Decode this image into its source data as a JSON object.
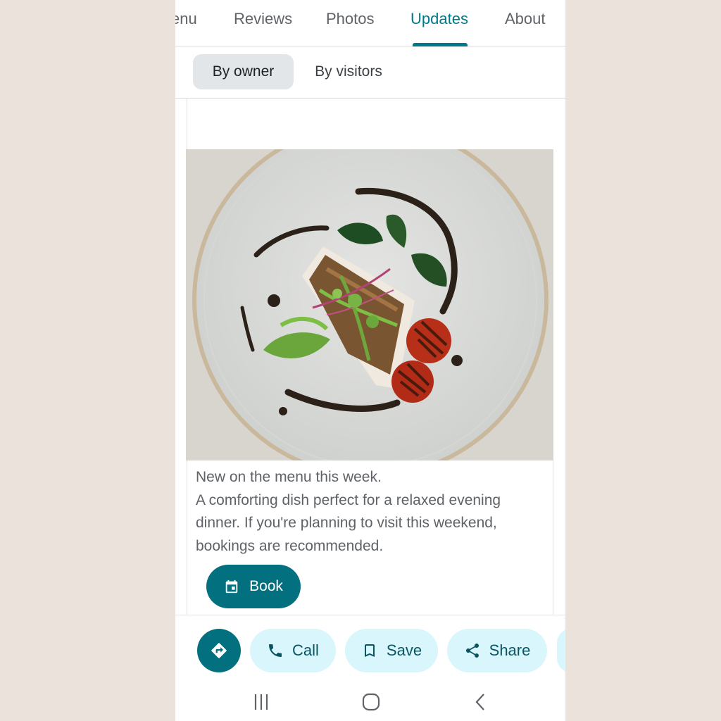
{
  "tabs": [
    {
      "label": "enu",
      "active": false
    },
    {
      "label": "Reviews",
      "active": false
    },
    {
      "label": "Photos",
      "active": false
    },
    {
      "label": "Updates",
      "active": true
    },
    {
      "label": "About",
      "active": false
    }
  ],
  "filter_chips": [
    {
      "label": "By owner",
      "selected": true
    },
    {
      "label": "By visitors",
      "selected": false
    }
  ],
  "post": {
    "image_icon": "plated-fish-dish-photo",
    "line1": "New on the menu this week.",
    "line2": "A comforting dish perfect for a relaxed evening dinner. If you're planning to visit this weekend, bookings are recommended.",
    "book_label": "Book",
    "book_icon": "calendar-icon"
  },
  "actions": {
    "directions_icon": "directions-icon",
    "call_label": "Call",
    "save_label": "Save",
    "share_label": "Share"
  },
  "nav": {
    "recent_icon": "recent-apps-icon",
    "home_icon": "home-icon",
    "back_icon": "back-icon"
  },
  "colors": {
    "accent": "#00798a",
    "button_fill": "#03707f",
    "pill_fill": "#d8f6fb",
    "page_background": "#ebe2dc"
  }
}
